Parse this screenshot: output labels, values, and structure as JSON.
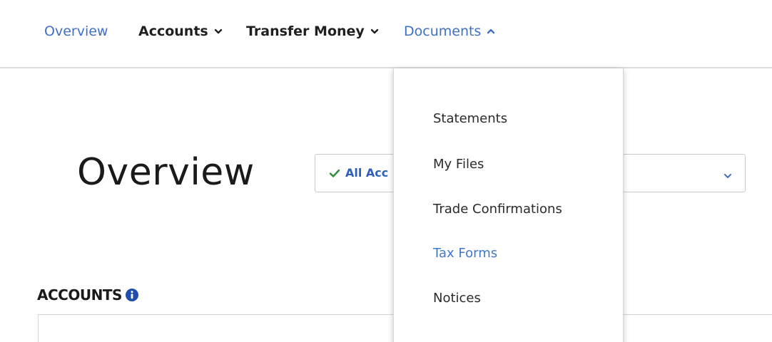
{
  "nav": {
    "items": [
      {
        "label": "Overview",
        "has_caret": false,
        "state": "link"
      },
      {
        "label": "Accounts",
        "has_caret": true,
        "caret": "chevron-down-icon"
      },
      {
        "label": "Transfer Money",
        "has_caret": true,
        "caret": "chevron-down-icon"
      },
      {
        "label": "Documents",
        "has_caret": true,
        "caret": "chevron-up-icon",
        "state": "open"
      }
    ]
  },
  "main": {
    "title": "Overview",
    "account_select": {
      "value": "All Acc",
      "icon": "check-icon",
      "chevron": "chevron-down-icon"
    },
    "accounts_heading": "ACCOUNTS",
    "accounts_info_icon": "info-icon"
  },
  "documents_menu": {
    "items": [
      {
        "label": "Statements"
      },
      {
        "label": "My Files"
      },
      {
        "label": "Trade Confirmations"
      },
      {
        "label": "Tax Forms",
        "state": "highlighted"
      },
      {
        "label": "Notices"
      }
    ]
  },
  "colors": {
    "link_blue": "#3f6fc8",
    "highlight_blue": "#3f78cf",
    "check_green": "#2e8b3a",
    "info_blue": "#1f4fa8",
    "text_dark": "#1f1f1f",
    "divider": "#dcdcdc"
  }
}
